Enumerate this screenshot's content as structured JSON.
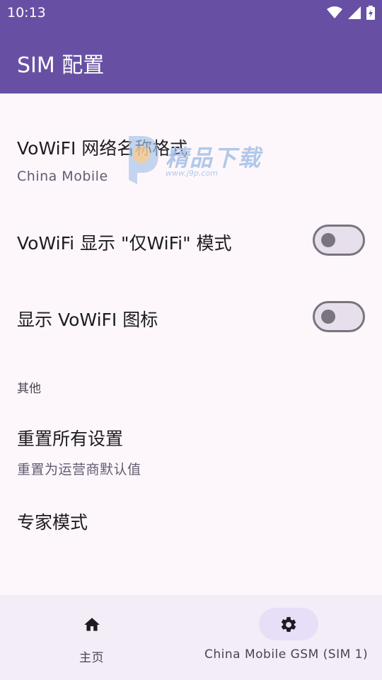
{
  "status_bar": {
    "time": "10:13",
    "icons": [
      "wifi-icon",
      "signal-icon",
      "battery-icon"
    ]
  },
  "app_bar": {
    "title": "SIM 配置"
  },
  "preferences": {
    "network_name_format": {
      "title": "VoWiFI 网络名称格式",
      "summary": "China Mobile"
    },
    "wifi_only_mode": {
      "title": "VoWiFi 显示 \"仅WiFi\" 模式",
      "checked": false
    },
    "show_vowifi_icon": {
      "title": "显示 VoWiFI 图标",
      "checked": false
    },
    "section_other": {
      "label": "其他"
    },
    "reset_all": {
      "title": "重置所有设置",
      "summary": "重置为运营商默认值"
    },
    "expert_mode": {
      "title": "专家模式"
    }
  },
  "watermark": {
    "text": "精品下载",
    "url": "www.j9p.com"
  },
  "bottom_nav": {
    "items": [
      {
        "label": "主页",
        "icon": "home-icon",
        "active": false
      },
      {
        "label": "China Mobile GSM (SIM 1)",
        "icon": "gear-icon",
        "active": true
      }
    ]
  },
  "colors": {
    "primary": "#6750a4",
    "background": "#fdf7fc",
    "nav_background": "#f3edf7",
    "nav_active": "#e8def8"
  }
}
